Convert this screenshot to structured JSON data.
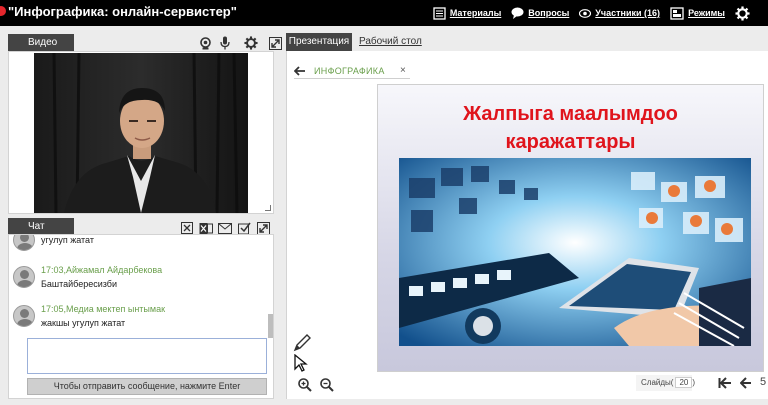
{
  "app": {
    "title": "\"Инфографика: онлайн-сервистер\""
  },
  "topnav": [
    {
      "icon": "materials-icon",
      "label": "Материалы"
    },
    {
      "icon": "questions-icon",
      "label": "Вопросы"
    },
    {
      "icon": "participants-icon",
      "label": "Участники (16)"
    },
    {
      "icon": "modes-icon",
      "label": "Режимы"
    }
  ],
  "video": {
    "tab_label": "Видео"
  },
  "chat": {
    "tab_label": "Чат",
    "messages": [
      {
        "time": "",
        "author": "",
        "text": "угулуп жатат"
      },
      {
        "time": "17:03,",
        "author": "Айжамал Айдарбекова",
        "text": "Баштайбересизби"
      },
      {
        "time": "17:05,",
        "author": "Медиа мектеп ынтымак",
        "text": "жакшы угулуп жатат"
      }
    ],
    "input_value": "",
    "send_hint": "Чтобы отправить сообщение, нажмите Enter"
  },
  "presentation": {
    "tab_label": "Презентация",
    "desktop_tab_label": "Рабочий стол",
    "document_name": "ИНФОГРАФИКА",
    "close_glyph": "×",
    "slide_title_1": "Жалпыга маалымдоо",
    "slide_title_2": "каражаттары",
    "pager_label": "Слайды(",
    "pager_value": "20",
    "pager_close": ")",
    "page_number": "5"
  },
  "colors": {
    "topbar": "#000000",
    "tab": "#444444",
    "accent_green": "#6a9f4c",
    "slide_title": "#e0141c",
    "record": "#e4262c"
  }
}
